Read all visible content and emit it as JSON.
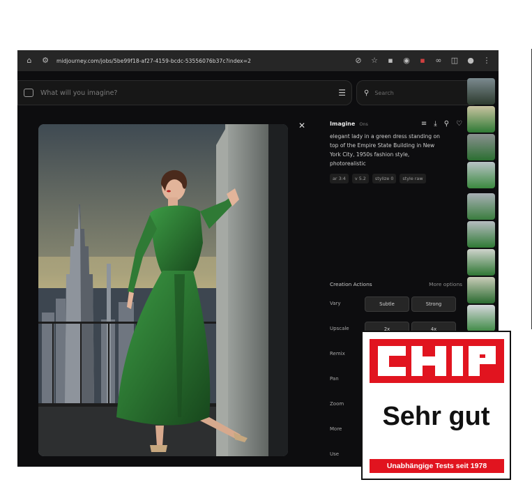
{
  "browser": {
    "url": "midjourney.com/jobs/5be99f18-af27-4159-bcdc-53556076b37c?index=2"
  },
  "prompt_bar": {
    "placeholder": "What will you imagine?"
  },
  "search": {
    "placeholder": "Search"
  },
  "panel": {
    "title": "Imagine",
    "subtitle": "Ons",
    "prompt": "elegant lady in a green dress standing on top of the Empire State Building in New York City, 1950s fashion style, photorealistic",
    "chips": [
      "ar 3:4",
      "v 5.2",
      "stylize 0",
      "style raw"
    ]
  },
  "creation_actions": {
    "title": "Creation Actions",
    "more": "More options",
    "vary_label": "Vary",
    "vary_subtle": "Subtle",
    "vary_strong": "Strong",
    "upscale_label": "Upscale",
    "upscale_2x": "2x",
    "upscale_4x": "4x",
    "remix_label": "Remix",
    "pan_label": "Pan",
    "zoom_label": "Zoom",
    "more_label": "More",
    "use_label": "Use"
  },
  "badge": {
    "logo": "CHIP",
    "rating": "Sehr gut",
    "footer": "Unabhängige Tests seit 1978"
  },
  "colors": {
    "badge_red": "#e1141f",
    "dark_bg": "#0d0d0f",
    "dress_green": "#2f7a35"
  }
}
